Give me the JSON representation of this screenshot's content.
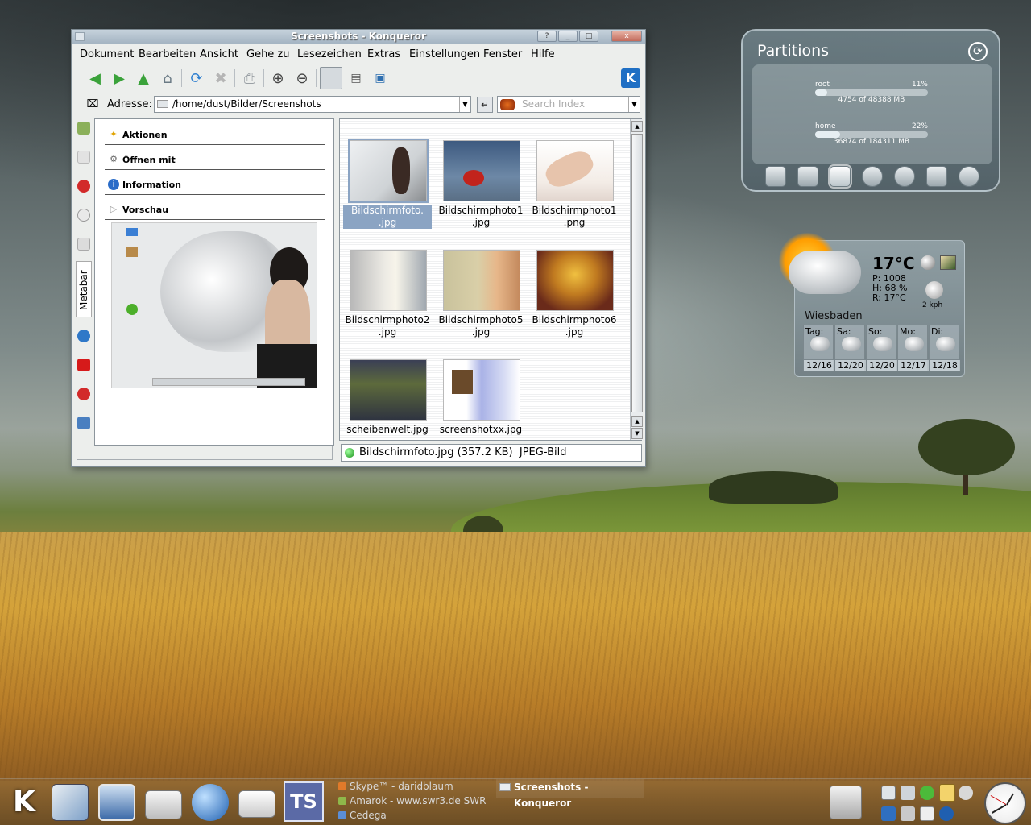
{
  "window": {
    "title": "Screenshots - Konqueror",
    "buttons": {
      "help": "?",
      "minimize": "_",
      "maximize": "□",
      "close": "x"
    }
  },
  "menu": [
    "Dokument",
    "Bearbeiten",
    "Ansicht",
    "Gehe zu",
    "Lesezeichen",
    "Extras",
    "Einstellungen",
    "Fenster",
    "Hilfe"
  ],
  "toolbar": {
    "icons": [
      "back-arrow-icon",
      "forward-arrow-icon",
      "up-arrow-icon",
      "home-icon",
      "reload-icon",
      "stop-icon",
      "print-icon",
      "zoom-in-icon",
      "zoom-out-icon",
      "icon-view-icon",
      "detail-view-icon",
      "preview-icon",
      "kde-logo-icon"
    ],
    "kde_badge": "K"
  },
  "location": {
    "label": "Adresse:",
    "path": "/home/dust/Bilder/Screenshots",
    "search_placeholder": "Search Index"
  },
  "sidebar": {
    "metabar_tab": "Metabar",
    "sections": [
      {
        "label": "Aktionen",
        "icon": "wand-icon"
      },
      {
        "label": "Öffnen mit",
        "icon": "gear-icon"
      },
      {
        "label": "Information",
        "icon": "info-icon"
      },
      {
        "label": "Vorschau",
        "icon": "triangle-icon"
      }
    ]
  },
  "files": [
    {
      "name": "Bildschirmfoto.\n.jpg",
      "selected": true
    },
    {
      "name": "Bildschirmphoto1\n.jpg",
      "selected": false
    },
    {
      "name": "Bildschirmphoto1\n.png",
      "selected": false
    },
    {
      "name": "Bildschirmphoto2\n.jpg",
      "selected": false
    },
    {
      "name": "Bildschirmphoto5\n.jpg",
      "selected": false
    },
    {
      "name": "Bildschirmphoto6\n.jpg",
      "selected": false
    },
    {
      "name": "scheibenwelt.jpg",
      "selected": false
    },
    {
      "name": "screenshotxx.jpg",
      "selected": false
    }
  ],
  "status": {
    "text": "Bildschirmfoto.jpg (357.2 KB)  JPEG-Bild"
  },
  "partitions": {
    "title": "Partitions",
    "items": [
      {
        "name": "root",
        "percent": "11%",
        "usage": "4754 of 48388 MB",
        "fraction": 0.11
      },
      {
        "name": "home",
        "percent": "22%",
        "usage": "36874 of 184311 MB",
        "fraction": 0.22
      }
    ],
    "icons": [
      "computer-icon",
      "hardware-icon",
      "harddisk-icon",
      "network-icon",
      "alarm-clock-icon",
      "calendar-icon",
      "cdrom-icon"
    ]
  },
  "weather": {
    "temp": "17°C",
    "pressure": "P: 1008",
    "humidity": "H: 68 %",
    "realfeel": "R: 17°C",
    "wind": "2 kph",
    "city": "Wiesbaden",
    "days": [
      {
        "name": "Tag:",
        "temps": "12/16"
      },
      {
        "name": "Sa:",
        "temps": "12/20"
      },
      {
        "name": "So:",
        "temps": "12/20"
      },
      {
        "name": "Mo:",
        "temps": "12/17"
      },
      {
        "name": "Di:",
        "temps": "12/18"
      }
    ]
  },
  "taskbar": {
    "kmenu": "K",
    "ts_label": "TS",
    "tasks": [
      {
        "label": "Skype™ - daridblaum",
        "color": "#e07a2a"
      },
      {
        "label": "Amarok - www.swr3.de SWR",
        "color": "#8fb84a"
      },
      {
        "label": "Cedega",
        "color": "#5b8ed6"
      }
    ],
    "active_task": "Screenshots - Konqueror"
  }
}
